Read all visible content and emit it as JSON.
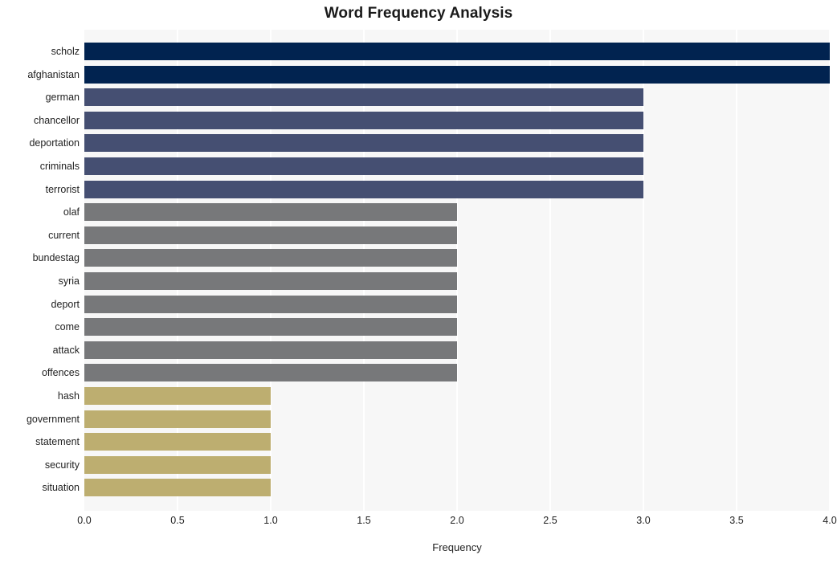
{
  "chart_data": {
    "type": "bar",
    "orientation": "horizontal",
    "title": "Word Frequency Analysis",
    "xlabel": "Frequency",
    "ylabel": "",
    "xlim": [
      0.0,
      4.0
    ],
    "xticks": [
      "0.0",
      "0.5",
      "1.0",
      "1.5",
      "2.0",
      "2.5",
      "3.0",
      "3.5",
      "4.0"
    ],
    "xtick_values": [
      0.0,
      0.5,
      1.0,
      1.5,
      2.0,
      2.5,
      3.0,
      3.5,
      4.0
    ],
    "grid": "vertical-white-on-light-gray",
    "legend": "none",
    "categories": [
      "scholz",
      "afghanistan",
      "german",
      "chancellor",
      "deportation",
      "criminals",
      "terrorist",
      "olaf",
      "current",
      "bundestag",
      "syria",
      "deport",
      "come",
      "attack",
      "offences",
      "hash",
      "government",
      "statement",
      "security",
      "situation"
    ],
    "values": [
      4,
      4,
      3,
      3,
      3,
      3,
      3,
      2,
      2,
      2,
      2,
      2,
      2,
      2,
      2,
      1,
      1,
      1,
      1,
      1
    ],
    "bar_colors": [
      "#012350",
      "#012350",
      "#454f72",
      "#454f72",
      "#454f72",
      "#454f72",
      "#454f72",
      "#77787a",
      "#77787a",
      "#77787a",
      "#77787a",
      "#77787a",
      "#77787a",
      "#77787a",
      "#77787a",
      "#bdae70",
      "#bdae70",
      "#bdae70",
      "#bdae70",
      "#bdae70"
    ],
    "palette": {
      "value_4": "#012350",
      "value_3": "#454f72",
      "value_2": "#77787a",
      "value_1": "#bdae70",
      "plot_background": "#f7f7f7",
      "gridline": "#ffffff",
      "figure_background": "#ffffff",
      "text": "#222222"
    }
  }
}
